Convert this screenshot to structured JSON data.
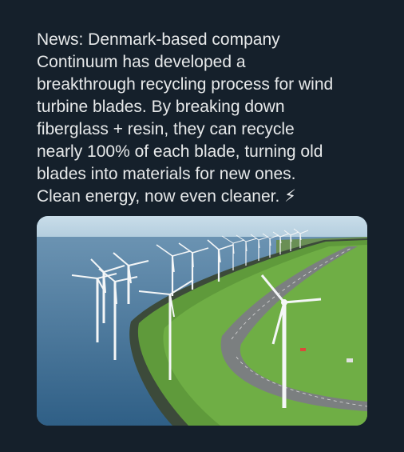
{
  "post": {
    "text_lines": [
      "News: Denmark-based company",
      "Continuum has developed a",
      "breakthrough recycling process for wind",
      "turbine blades. By breaking down",
      "fiberglass + resin, they can recycle",
      "nearly 100% of each blade, turning old",
      "blades into materials for new ones.",
      "Clean energy, now even cleaner. ⚡"
    ]
  },
  "media": {
    "subject": "wind turbines along a green dike beside water and a highway",
    "colors": {
      "sky": "#b9d3e3",
      "water": "#3d6f95",
      "grass": "#5f9a3b",
      "turbine": "#f4f6f7"
    }
  },
  "theme": {
    "background": "#15202b",
    "text": "#e7e9ea"
  }
}
